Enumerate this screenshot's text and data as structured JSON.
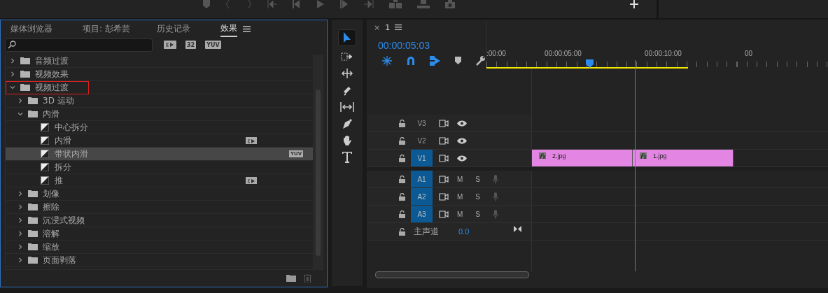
{
  "panel_tabs": [
    {
      "label": "媒体浏览器",
      "selected": false
    },
    {
      "label": "项目: 彭希芸",
      "selected": false
    },
    {
      "label": "历史记录",
      "selected": false
    },
    {
      "label": "效果",
      "selected": true
    }
  ],
  "filter_buttons": [
    {
      "kind": "accelerated"
    },
    {
      "kind": "bit32",
      "label": "32"
    },
    {
      "kind": "yuv",
      "label": "YUV"
    }
  ],
  "effects_tree": [
    {
      "label": "音频过渡",
      "kind": "folder",
      "expanded": false,
      "highlighted": false,
      "selected": false
    },
    {
      "label": "视频效果",
      "kind": "folder",
      "expanded": false,
      "highlighted": false,
      "selected": false
    },
    {
      "label": "视频过渡",
      "kind": "folder",
      "expanded": true,
      "highlighted": true,
      "selected": false,
      "children": [
        {
          "label": "3D 运动",
          "kind": "folder",
          "expanded": false,
          "highlighted": false,
          "selected": false
        },
        {
          "label": "内滑",
          "kind": "folder",
          "expanded": true,
          "highlighted": false,
          "selected": false,
          "children": [
            {
              "label": "中心拆分",
              "kind": "effect",
              "highlighted": false,
              "selected": false
            },
            {
              "label": "内滑",
              "kind": "effect",
              "highlighted": false,
              "selected": false,
              "badge": {
                "kind": "accelerated"
              }
            },
            {
              "label": "带状内滑",
              "kind": "effect",
              "highlighted": false,
              "selected": true,
              "badge": {
                "kind": "yuv",
                "label": "YUV"
              }
            },
            {
              "label": "拆分",
              "kind": "effect",
              "highlighted": false,
              "selected": false
            },
            {
              "label": "推",
              "kind": "effect",
              "highlighted": false,
              "selected": false,
              "badge": {
                "kind": "accelerated"
              }
            }
          ]
        },
        {
          "label": "划像",
          "kind": "folder",
          "expanded": false,
          "highlighted": false,
          "selected": false
        },
        {
          "label": "擦除",
          "kind": "folder",
          "expanded": false,
          "highlighted": false,
          "selected": false
        },
        {
          "label": "沉浸式视频",
          "kind": "folder",
          "expanded": false,
          "highlighted": false,
          "selected": false
        },
        {
          "label": "溶解",
          "kind": "folder",
          "expanded": false,
          "highlighted": false,
          "selected": false
        },
        {
          "label": "缩放",
          "kind": "folder",
          "expanded": false,
          "highlighted": false,
          "selected": false
        },
        {
          "label": "页面剥落",
          "kind": "folder",
          "expanded": false,
          "highlighted": false,
          "selected": false
        }
      ]
    }
  ],
  "timeline": {
    "close_glyph": "×",
    "sequence_tab": "1",
    "timecode": "00:00:05:03",
    "ruler_labels": [
      ":00:00",
      "00:00:05:00",
      "00:00:10:00",
      "00"
    ],
    "video_tracks": [
      {
        "name": "V3",
        "targeted": false
      },
      {
        "name": "V2",
        "targeted": false
      },
      {
        "name": "V1",
        "targeted": true
      }
    ],
    "audio_tracks": [
      {
        "name": "A1",
        "targeted": true,
        "mute": "M",
        "solo": "S"
      },
      {
        "name": "A2",
        "targeted": true,
        "mute": "M",
        "solo": "S"
      },
      {
        "name": "A3",
        "targeted": true,
        "mute": "M",
        "solo": "S"
      }
    ],
    "master": {
      "label": "主声道",
      "value": "0.0"
    },
    "clips": [
      {
        "name": "2.jpg"
      },
      {
        "name": "1.jpg"
      }
    ]
  }
}
